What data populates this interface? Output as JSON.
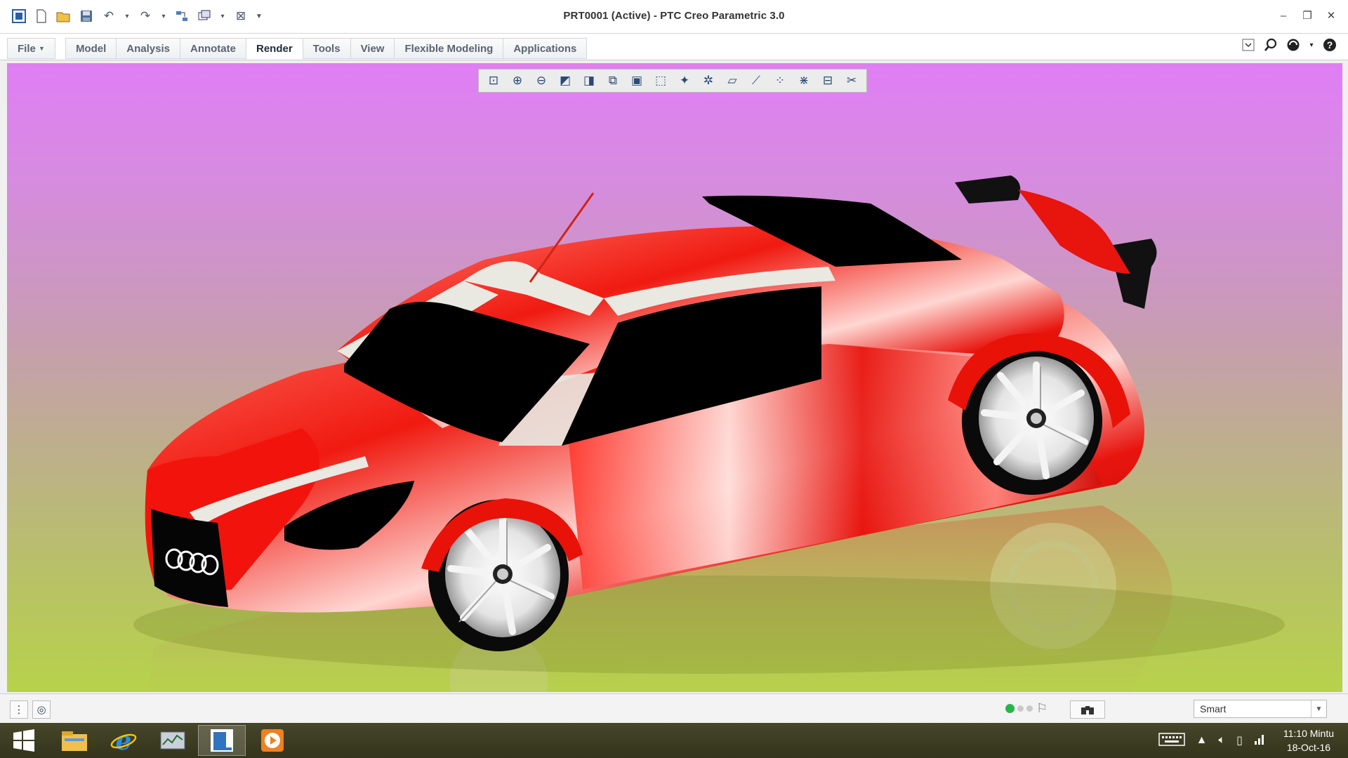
{
  "window": {
    "title": "PRT0001 (Active) - PTC Creo Parametric 3.0"
  },
  "ribbon": {
    "tabs": [
      "File",
      "Model",
      "Analysis",
      "Annotate",
      "Render",
      "Tools",
      "View",
      "Flexible Modeling",
      "Applications"
    ],
    "active_tab": "Render"
  },
  "view_toolbar": {
    "icons": [
      "refit-icon",
      "zoom-in-icon",
      "zoom-out-icon",
      "repaint-icon",
      "display-style-icon",
      "saved-orientations-icon",
      "view-manager-icon",
      "perspective-view-icon",
      "spin-center-icon",
      "datum-display-icon",
      "plane-display-icon",
      "axis-display-icon",
      "point-display-icon",
      "csys-display-icon",
      "annotation-display-icon",
      "appearance-icon"
    ]
  },
  "model": {
    "name": "Audi concept car",
    "badge_text": "",
    "body_color": "#e8140e",
    "window_color": "#000000",
    "trim_color": "#e8e8e0"
  },
  "status_bar": {
    "filter_value": "Smart"
  },
  "taskbar": {
    "clock_time": "11:10 Mintu",
    "clock_date": "18-Oct-16"
  }
}
